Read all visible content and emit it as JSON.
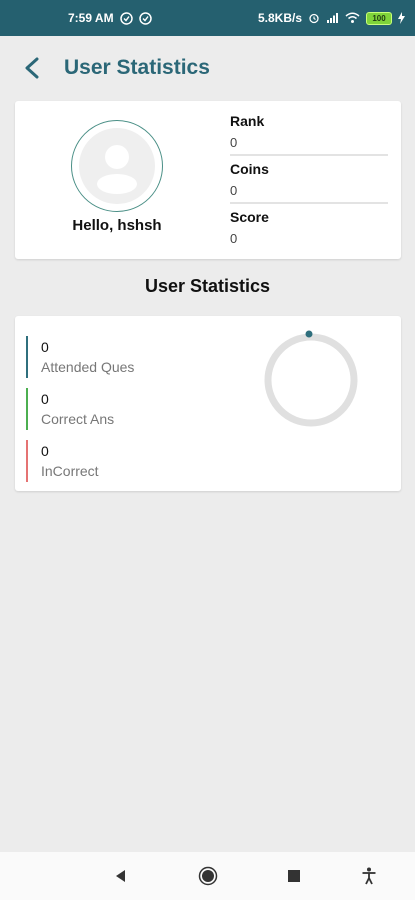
{
  "status_bar": {
    "time": "7:59 AM",
    "network_speed": "5.8KB/s",
    "battery": "100",
    "icons": [
      "notification-icon",
      "notification-icon",
      "alarm-icon",
      "signal-icon",
      "wifi-icon",
      "battery-icon",
      "charging-icon"
    ]
  },
  "app_bar": {
    "title": "User Statistics",
    "back_icon": "back-arrow-icon"
  },
  "profile": {
    "greeting": "Hello, hshsh",
    "avatar_icon": "user-avatar-icon",
    "stats": [
      {
        "label": "Rank",
        "value": "0"
      },
      {
        "label": "Coins",
        "value": "0"
      },
      {
        "label": "Score",
        "value": "0"
      }
    ]
  },
  "section_title": "User Statistics",
  "statistics": {
    "items": [
      {
        "value": "0",
        "label": "Attended Ques",
        "color": "#2f6f7d"
      },
      {
        "value": "0",
        "label": "Correct Ans",
        "color": "#4caf50"
      },
      {
        "value": "0",
        "label": "InCorrect",
        "color": "#e57373"
      }
    ],
    "ring_color": "#e0e0e0",
    "indicator_color": "#2f6f7d"
  },
  "nav_bar": {
    "icons": [
      "back-triangle-icon",
      "home-circle-icon",
      "recents-square-icon",
      "accessibility-icon"
    ]
  }
}
